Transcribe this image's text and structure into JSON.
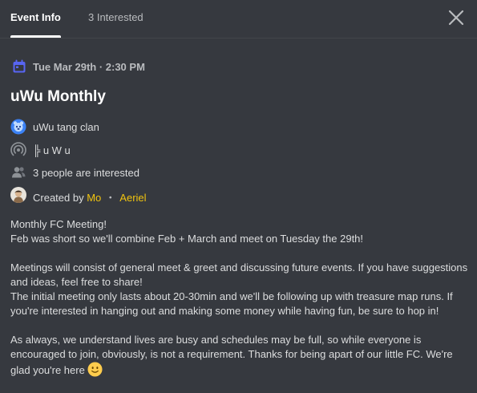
{
  "tabs": {
    "event_info": "Event Info",
    "interested": "3 Interested"
  },
  "event": {
    "date": "Tue Mar 29th · 2:30 PM",
    "title": "uWu Monthly",
    "server": "uWu tang clan",
    "channel": "╠ u W u",
    "interested_text": "3 people are interested",
    "created_by_label": "Created by",
    "creator_name": "Mo",
    "creator_separator": "・",
    "creator_suffix": "Aeriel"
  },
  "description": {
    "line1": "Monthly FC Meeting!",
    "line2": "Feb was short so we'll combine Feb + March and meet on Tuesday the 29th!",
    "line3": "Meetings will consist of general meet & greet and discussing future events. If you have suggestions and ideas, feel free to share!",
    "line4": "The initial meeting only lasts about 20-30min and we'll be following up with treasure map runs. If you're interested in hanging out and making some money while having fun, be sure to hop in!",
    "line5": "As always, we understand lives are busy and schedules may be full, so while everyone is encouraged to join, obviously, is not a requirement. Thanks for being apart of our little FC. We're glad you're here"
  },
  "icons": {
    "calendar": "calendar-icon",
    "close": "close-icon",
    "server": "server-icon",
    "channel": "stage-channel-icon",
    "people": "people-icon",
    "avatar": "avatar",
    "emoji": "slight-smile-emoji"
  },
  "colors": {
    "background": "#36393f",
    "calendar_accent": "#5865f2",
    "creator_accent": "#f1c40f",
    "server_icon": "#3b82f6"
  }
}
